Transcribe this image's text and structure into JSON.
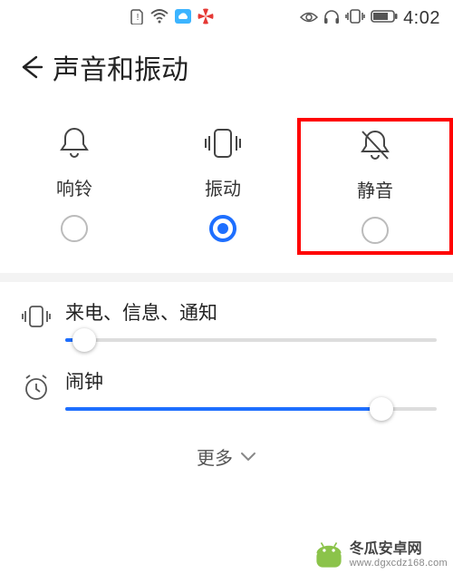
{
  "status": {
    "time": "4:02"
  },
  "header": {
    "title": "声音和振动"
  },
  "modes": {
    "ring": {
      "label": "响铃",
      "selected": false
    },
    "vibrate": {
      "label": "振动",
      "selected": true
    },
    "mute": {
      "label": "静音",
      "selected": false
    }
  },
  "sliders": {
    "notify": {
      "label": "来电、信息、通知",
      "percent": 5
    },
    "alarm": {
      "label": "闹钟",
      "percent": 85
    }
  },
  "more_label": "更多",
  "watermark": {
    "line1": "冬瓜安卓网",
    "line2": "www.dgxcdz168.com"
  }
}
